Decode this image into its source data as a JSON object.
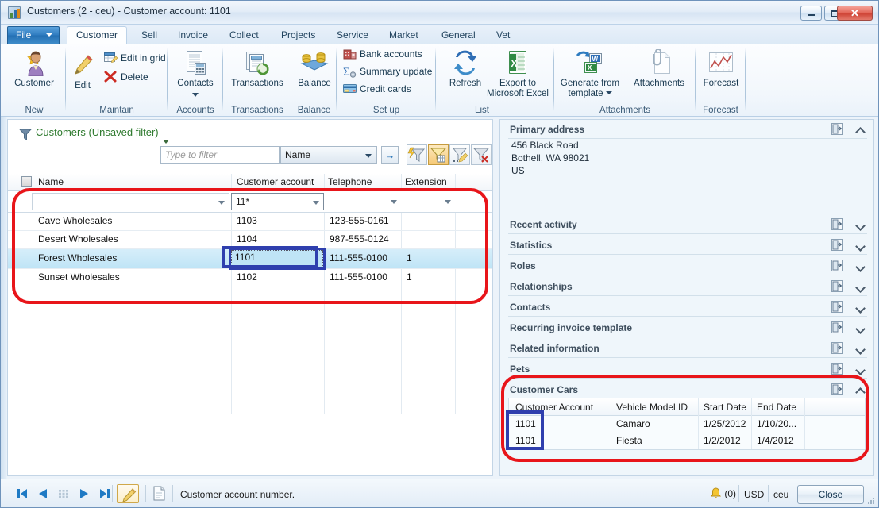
{
  "window": {
    "title": "Customers (2 - ceu) - Customer account: 1101",
    "minimize_label": "",
    "maximize_label": "",
    "close_label": "✕"
  },
  "ribbon": {
    "file_tab": "File",
    "tabs": [
      {
        "label": "Customer",
        "active": true
      },
      {
        "label": "Sell",
        "active": false
      },
      {
        "label": "Invoice",
        "active": false
      },
      {
        "label": "Collect",
        "active": false
      },
      {
        "label": "Projects",
        "active": false
      },
      {
        "label": "Service",
        "active": false
      },
      {
        "label": "Market",
        "active": false
      },
      {
        "label": "General",
        "active": false
      },
      {
        "label": "Vet",
        "active": false
      }
    ],
    "groups": [
      {
        "name": "New",
        "buttons": [
          "Customer"
        ]
      },
      {
        "name": "Maintain",
        "buttons": [
          "Edit",
          "Edit in grid",
          "Delete"
        ]
      },
      {
        "name": "Accounts",
        "buttons": [
          "Contacts"
        ]
      },
      {
        "name": "Transactions",
        "buttons": [
          "Transactions"
        ]
      },
      {
        "name": "Balance",
        "buttons": [
          "Balance"
        ]
      },
      {
        "name": "Set up",
        "buttons": [
          "Bank accounts",
          "Summary update",
          "Credit cards"
        ]
      },
      {
        "name": "List",
        "buttons": [
          "Refresh",
          "Export to Microsoft Excel"
        ]
      },
      {
        "name": "Attachments",
        "buttons": [
          "Generate from template",
          "Attachments"
        ]
      },
      {
        "name": "Forecast",
        "buttons": [
          "Forecast"
        ]
      }
    ],
    "labels": {
      "customer": "Customer",
      "edit": "Edit",
      "edit_in_grid": "Edit in grid",
      "delete": "Delete",
      "contacts": "Contacts",
      "transactions": "Transactions",
      "balance": "Balance",
      "bank_accounts": "Bank accounts",
      "summary_update": "Summary update",
      "credit_cards": "Credit cards",
      "refresh": "Refresh",
      "export_excel_line1": "Export to",
      "export_excel_line2": "Microsoft Excel",
      "generate_line1": "Generate from",
      "generate_line2": "template",
      "attachments": "Attachments",
      "forecast": "Forecast"
    },
    "group_names": {
      "new": "New",
      "maintain": "Maintain",
      "accounts": "Accounts",
      "transactions": "Transactions",
      "balance": "Balance",
      "setup": "Set up",
      "list": "List",
      "attachments": "Attachments",
      "forecast": "Forecast"
    },
    "help_glyph": "?"
  },
  "list_page": {
    "caption": "Customers (Unsaved filter)",
    "filter": {
      "placeholder": "Type to filter",
      "value": "",
      "column_selected": "Name",
      "go_glyph": "→"
    },
    "filter_buttons": [
      {
        "name": "advanced-filter-sort",
        "selected": false
      },
      {
        "name": "filter-by-grid",
        "selected": true
      },
      {
        "name": "filter-by-selection",
        "selected": false
      },
      {
        "name": "clear-filter",
        "selected": false
      }
    ],
    "columns": [
      "Name",
      "Customer account",
      "Telephone",
      "Extension"
    ],
    "filter_row": [
      "",
      "11*",
      "",
      ""
    ],
    "rows": [
      {
        "name": "Cave Wholesales",
        "account": "1103",
        "telephone": "123-555-0161",
        "extension": "",
        "selected": false
      },
      {
        "name": "Desert Wholesales",
        "account": "1104",
        "telephone": "987-555-0124",
        "extension": "",
        "selected": false
      },
      {
        "name": "Forest Wholesales",
        "account": "1101",
        "telephone": "111-555-0100",
        "extension": "1",
        "selected": true
      },
      {
        "name": "Sunset Wholesales",
        "account": "1102",
        "telephone": "111-555-0100",
        "extension": "1",
        "selected": false
      }
    ],
    "active_cell_value": "1101"
  },
  "factbox": {
    "sections": [
      {
        "title": "Primary address",
        "expanded": true
      },
      {
        "title": "Recent activity",
        "expanded": false
      },
      {
        "title": "Statistics",
        "expanded": false
      },
      {
        "title": "Roles",
        "expanded": false
      },
      {
        "title": "Relationships",
        "expanded": false
      },
      {
        "title": "Contacts",
        "expanded": false
      },
      {
        "title": "Recurring invoice template",
        "expanded": false
      },
      {
        "title": "Related information",
        "expanded": false
      },
      {
        "title": "Pets",
        "expanded": false
      },
      {
        "title": "Customer Cars",
        "expanded": true
      }
    ],
    "primary_address": [
      "456 Black Road",
      "Bothell, WA 98021",
      "US"
    ],
    "customer_cars": {
      "title": "Customer Cars",
      "columns": [
        "Customer Account",
        "Vehicle Model ID",
        "Start Date",
        "End Date"
      ],
      "rows": [
        {
          "account": "1101",
          "model": "Camaro",
          "start": "1/25/2012",
          "end": "1/10/20..."
        },
        {
          "account": "1101",
          "model": "Fiesta",
          "start": "1/2/2012",
          "end": "1/4/2012"
        }
      ]
    }
  },
  "statusbar": {
    "nav": {
      "first": "⏮",
      "previous": "◀",
      "grid": "grid-view-icon",
      "next": "▶",
      "last": "⏭"
    },
    "edit_record_icon": "pencil-icon",
    "copy_icon": "clipboard-icon",
    "message": "Customer account number.",
    "alerts_count": "(0)",
    "currency": "USD",
    "company": "ceu",
    "close_label": "Close"
  },
  "colors": {
    "accent_blue": "#2f7cc0",
    "selection_row": "#bfe4f6",
    "annotation_red": "#e8151a",
    "annotation_blue": "#2f3fae",
    "caption_green": "#2e7a2e",
    "factbox_bg": "#eff6fb"
  }
}
